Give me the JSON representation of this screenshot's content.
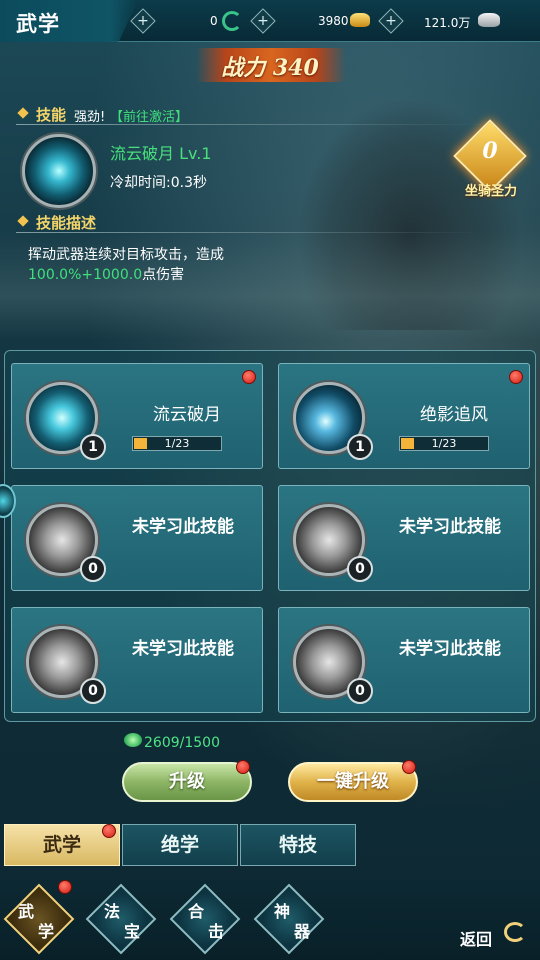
{
  "header": {
    "title": "武学",
    "jade": "0",
    "gold": "3980",
    "silver": "121.0万",
    "plus": "+"
  },
  "power": {
    "text": "战力 340"
  },
  "skill_info": {
    "label": "技能",
    "status": "强劲!",
    "link": "【前往激活】",
    "name": "流云破月  Lv.1",
    "cooldown": "冷却时间:0.3秒",
    "desc_label": "技能描述",
    "desc_line1": "挥动武器连续对目标攻击，造成",
    "desc_line2_green": "100.0%+1000.0",
    "desc_line2_tail": "点伤害"
  },
  "mount": {
    "value": "0",
    "label": "坐骑圣力"
  },
  "skills": [
    {
      "name": "流云破月",
      "level": "1",
      "progress": "1/23",
      "progress_fraction": 0.0435,
      "learned": true,
      "alert": true
    },
    {
      "name": "绝影追风",
      "level": "1",
      "progress": "1/23",
      "progress_fraction": 0.0435,
      "learned": true,
      "alert": true
    },
    {
      "name": "未学习此技能",
      "level": "0",
      "learned": false,
      "alert": false
    },
    {
      "name": "未学习此技能",
      "level": "0",
      "learned": false,
      "alert": false
    },
    {
      "name": "未学习此技能",
      "level": "0",
      "learned": false,
      "alert": false
    },
    {
      "name": "未学习此技能",
      "level": "0",
      "learned": false,
      "alert": false
    }
  ],
  "exp": {
    "text": "2609/1500"
  },
  "buttons": {
    "upgrade": "升级",
    "one_click": "一键升级"
  },
  "tabs": [
    {
      "label": "武学",
      "active": true,
      "alert": true
    },
    {
      "label": "绝学",
      "active": false,
      "alert": false
    },
    {
      "label": "特技",
      "active": false,
      "alert": false
    }
  ],
  "nav": [
    {
      "c1": "武",
      "c2": "学",
      "active": true,
      "alert": true
    },
    {
      "c1": "法",
      "c2": "宝",
      "active": false,
      "alert": false
    },
    {
      "c1": "合",
      "c2": "击",
      "active": false,
      "alert": false
    },
    {
      "c1": "神",
      "c2": "器",
      "active": false,
      "alert": false
    }
  ],
  "back": {
    "label": "返回"
  },
  "colors": {
    "accent_green": "#3fe07c",
    "accent_gold": "#f3d46a",
    "panel": "#2b7583",
    "alert_red": "#d31d12"
  }
}
